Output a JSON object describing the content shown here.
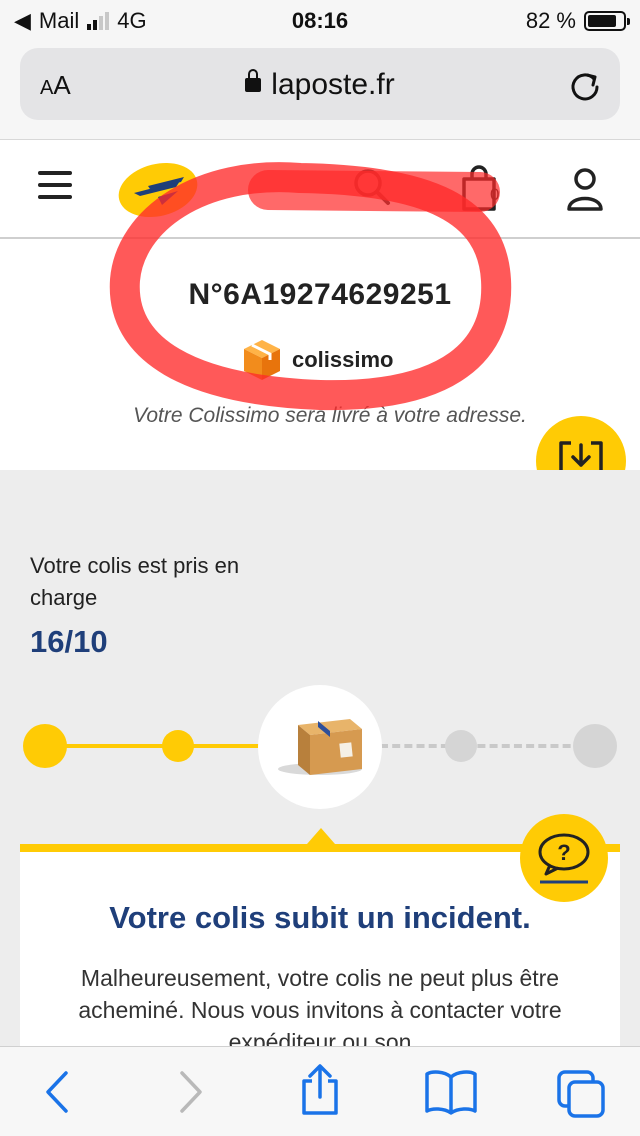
{
  "status_bar": {
    "carrier": "Mail",
    "network": "4G",
    "time": "08:16",
    "battery": "82 %",
    "battery_level": 0.82
  },
  "browser": {
    "text_size_label_small": "A",
    "text_size_label_large": "A",
    "url": "laposte.fr"
  },
  "header": {
    "cart_count": "0"
  },
  "tracking": {
    "number": "N°6A19274629251",
    "carrier_name": "colissimo",
    "delivery_note": "Votre Colissimo sera livré à votre adresse."
  },
  "status": {
    "text": "Votre colis est pris en charge",
    "date": "16/10"
  },
  "incident": {
    "title": "Votre colis subit un incident.",
    "body": "Malheureusement, votre colis ne peut plus être acheminé. Nous vous invitons à contacter votre expéditeur ou son"
  },
  "colors": {
    "brand_yellow": "#ffcb05",
    "brand_blue": "#1f3f7a",
    "annotation_red": "#ff2a2a",
    "ios_blue": "#1a73e8"
  }
}
